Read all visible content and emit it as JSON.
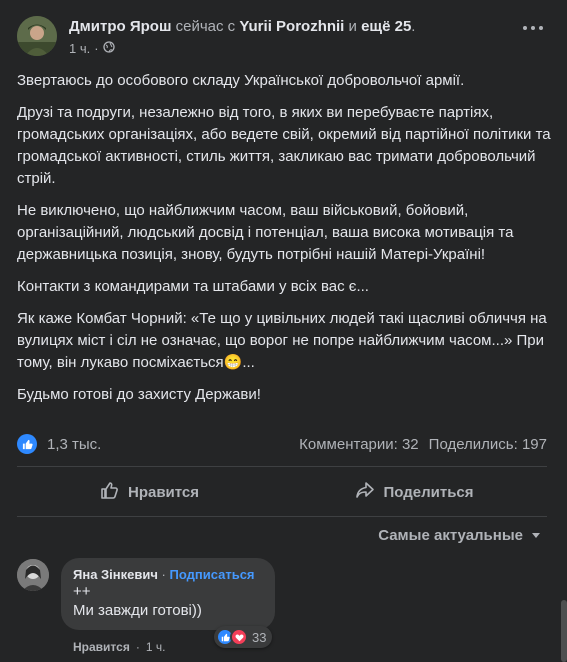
{
  "post": {
    "author": "Дмитро Ярош",
    "with_prefix": "сейчас с",
    "tagged": "Yurii Porozhnii",
    "and_text": "и",
    "more_count": "ещё 25",
    "suffix": ".",
    "time": "1 ч.",
    "paragraphs": [
      "Звертаюсь до особового складу Української добровольчої армії.",
      "Друзі та подруги, незалежно від того, в яких ви перебуваєте партіях, громадських організаціях, або ведете свій, окремий від партійної політики та громадської активності, стиль життя, закликаю вас тримати добровольчий стрій.",
      "Не виключено, що найближчим часом, ваш військовий, бойовий, організаційний, людський досвід і потенціал, ваша висока мотивація та державницька позиція, знову, будуть потрібні нашій Матері-Україні!",
      "Контакти з командирами та штабами у всіх вас є...",
      "Як каже Комбат Чорний: «Те що у цивільних людей такі щасливі обличчя на вулицях міст і сіл не означає, що ворог не попре найближчим часом...» При тому, він лукаво посміхається😁...",
      "Будьмо готові до захисту Держави!"
    ]
  },
  "stats": {
    "likes": "1,3 тыс.",
    "comments": "Комментарии: 32",
    "shares": "Поделились: 197"
  },
  "actions": {
    "like_label": "Нравится",
    "share_label": "Поделиться"
  },
  "sort": {
    "label": "Самые актуальные"
  },
  "comment": {
    "author": "Яна Зінкевич",
    "separator": "·",
    "follow": "Подписаться",
    "line1": "++",
    "line2": "Ми завжди готові))",
    "reaction_count": "33",
    "like_label": "Нравится",
    "separator2": "·",
    "time": "1 ч."
  },
  "colors": {
    "background": "#242526",
    "text": "#e4e6eb",
    "muted": "#b0b3b8",
    "accent": "#2e89ff",
    "love": "#f33e58"
  },
  "icons": {
    "globe": "globe-icon",
    "more": "more-options-icon",
    "thumbs_up": "thumbs-up-icon",
    "share": "share-arrow-icon",
    "chevron": "chevron-down-icon",
    "heart": "heart-icon"
  }
}
